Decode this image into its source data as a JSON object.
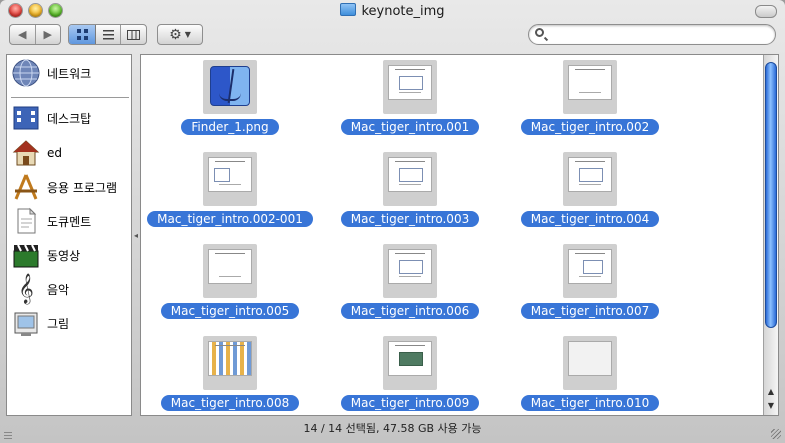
{
  "window": {
    "title": "keynote_img"
  },
  "toolbar": {
    "back_icon": "back-arrow-icon",
    "forward_icon": "forward-arrow-icon",
    "action_icon": "gear-icon",
    "search": {
      "value": "",
      "placeholder": ""
    }
  },
  "sidebar": {
    "items": [
      {
        "label": "네트워크",
        "icon": "network-globe-icon"
      },
      {
        "label": "데스크탑",
        "icon": "desktop-icon"
      },
      {
        "label": "ed",
        "icon": "home-icon"
      },
      {
        "label": "응용 프로그램",
        "icon": "applications-icon"
      },
      {
        "label": "도큐멘트",
        "icon": "documents-icon"
      },
      {
        "label": "동영상",
        "icon": "movies-icon"
      },
      {
        "label": "음악",
        "icon": "music-icon"
      },
      {
        "label": "그림",
        "icon": "pictures-icon"
      }
    ]
  },
  "files": [
    {
      "name": "Finder_1.png"
    },
    {
      "name": "Mac_tiger_intro.001"
    },
    {
      "name": "Mac_tiger_intro.002"
    },
    {
      "name": "Mac_tiger_intro.002-001"
    },
    {
      "name": "Mac_tiger_intro.003"
    },
    {
      "name": "Mac_tiger_intro.004"
    },
    {
      "name": "Mac_tiger_intro.005"
    },
    {
      "name": "Mac_tiger_intro.006"
    },
    {
      "name": "Mac_tiger_intro.007"
    },
    {
      "name": "Mac_tiger_intro.008"
    },
    {
      "name": "Mac_tiger_intro.009"
    },
    {
      "name": "Mac_tiger_intro.010"
    }
  ],
  "status": {
    "text": "14 / 14 선택됨, 47.58 GB 사용 가능"
  },
  "colors": {
    "selection": "#3875d7",
    "scroll_knob": "#2b6ad6"
  }
}
